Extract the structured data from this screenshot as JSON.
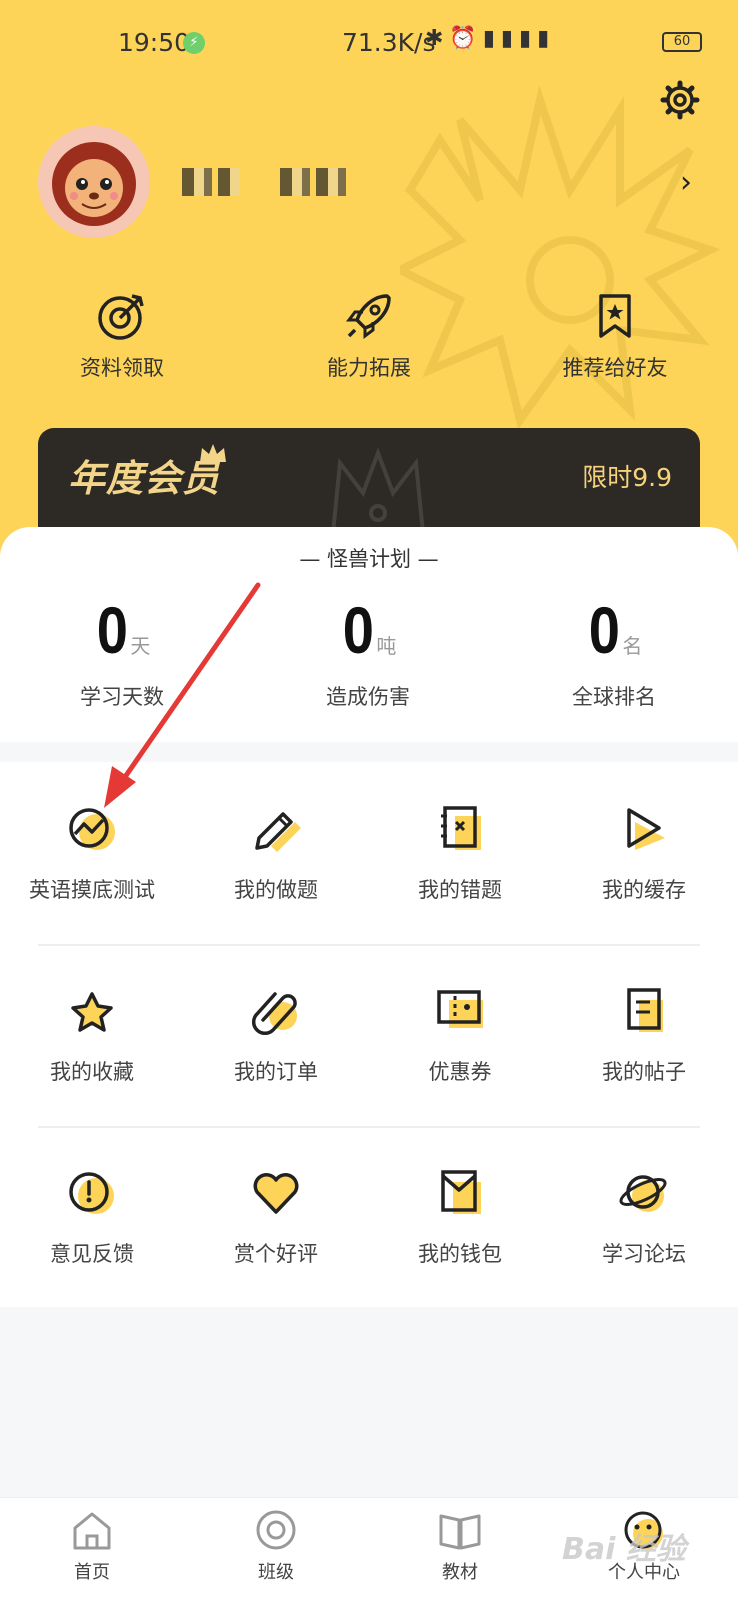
{
  "status_bar": {
    "time": "19:50",
    "speed": "71.3K/s",
    "battery": "60"
  },
  "shortcuts": [
    {
      "label": "资料领取",
      "icon": "target-icon"
    },
    {
      "label": "能力拓展",
      "icon": "rocket-icon"
    },
    {
      "label": "推荐给好友",
      "icon": "bookmark-star-icon"
    }
  ],
  "membership": {
    "title": "年度会员",
    "price": "限时9.9"
  },
  "plan": {
    "title": "— 怪兽计划 —",
    "stats": [
      {
        "value": "0",
        "unit": "天",
        "label": "学习天数"
      },
      {
        "value": "0",
        "unit": "吨",
        "label": "造成伤害"
      },
      {
        "value": "0",
        "unit": "名",
        "label": "全球排名"
      }
    ]
  },
  "menu": [
    {
      "label": "英语摸底测试",
      "icon": "chart-trend-icon"
    },
    {
      "label": "我的做题",
      "icon": "pencil-icon"
    },
    {
      "label": "我的错题",
      "icon": "wrong-notebook-icon"
    },
    {
      "label": "我的缓存",
      "icon": "play-icon"
    },
    {
      "label": "我的收藏",
      "icon": "star-icon"
    },
    {
      "label": "我的订单",
      "icon": "paperclip-icon"
    },
    {
      "label": "优惠券",
      "icon": "ticket-icon"
    },
    {
      "label": "我的帖子",
      "icon": "document-icon"
    },
    {
      "label": "意见反馈",
      "icon": "exclamation-icon"
    },
    {
      "label": "赏个好评",
      "icon": "heart-icon"
    },
    {
      "label": "我的钱包",
      "icon": "wallet-icon"
    },
    {
      "label": "学习论坛",
      "icon": "planet-icon"
    }
  ],
  "tabbar": [
    {
      "label": "首页",
      "icon": "home-icon"
    },
    {
      "label": "班级",
      "icon": "class-icon"
    },
    {
      "label": "教材",
      "icon": "book-icon"
    },
    {
      "label": "个人中心",
      "icon": "profile-face-icon"
    }
  ],
  "watermark": "Bai 经验",
  "colors": {
    "brand_yellow": "#fdd458",
    "accent_red": "#e53935",
    "member_dark": "#2d2a26",
    "member_gold": "#f5d27b"
  }
}
